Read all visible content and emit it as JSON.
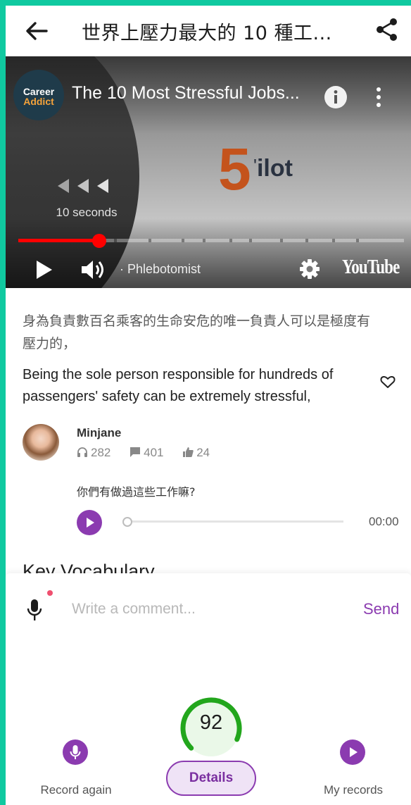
{
  "header": {
    "title": "世界上壓力最大的 10 種工..."
  },
  "video": {
    "channel_line1": "Career",
    "channel_line2": "Addict",
    "title": "The 10 Most Stressful Jobs...",
    "number": "5",
    "overlay_word": "ilot",
    "rewind_label": "10 seconds",
    "chapter": "· Phlebotomist",
    "brand": "YouTube",
    "progress_fraction": 0.21,
    "accent_color": "#ff0000"
  },
  "sentence": {
    "zh": "身為負責數百名乘客的生命安危的唯一負責人可以是極度有壓力的，",
    "en": "Being the sole person responsible for hundreds of passengers' safety can be extremely stressful,"
  },
  "comment": {
    "username": "Minjane",
    "listens": "282",
    "comments": "401",
    "likes": "24",
    "question": "你們有做過這些工作嘛?",
    "audio_time": "00:00"
  },
  "section": {
    "vocab_heading": "Key Vocabulary"
  },
  "composer": {
    "placeholder": "Write a comment...",
    "send_label": "Send"
  },
  "actions": {
    "record_again": "Record again",
    "details": "Details",
    "my_records": "My records",
    "score": "92",
    "brand_color": "#8b3bb0",
    "score_color": "#22a61c"
  }
}
